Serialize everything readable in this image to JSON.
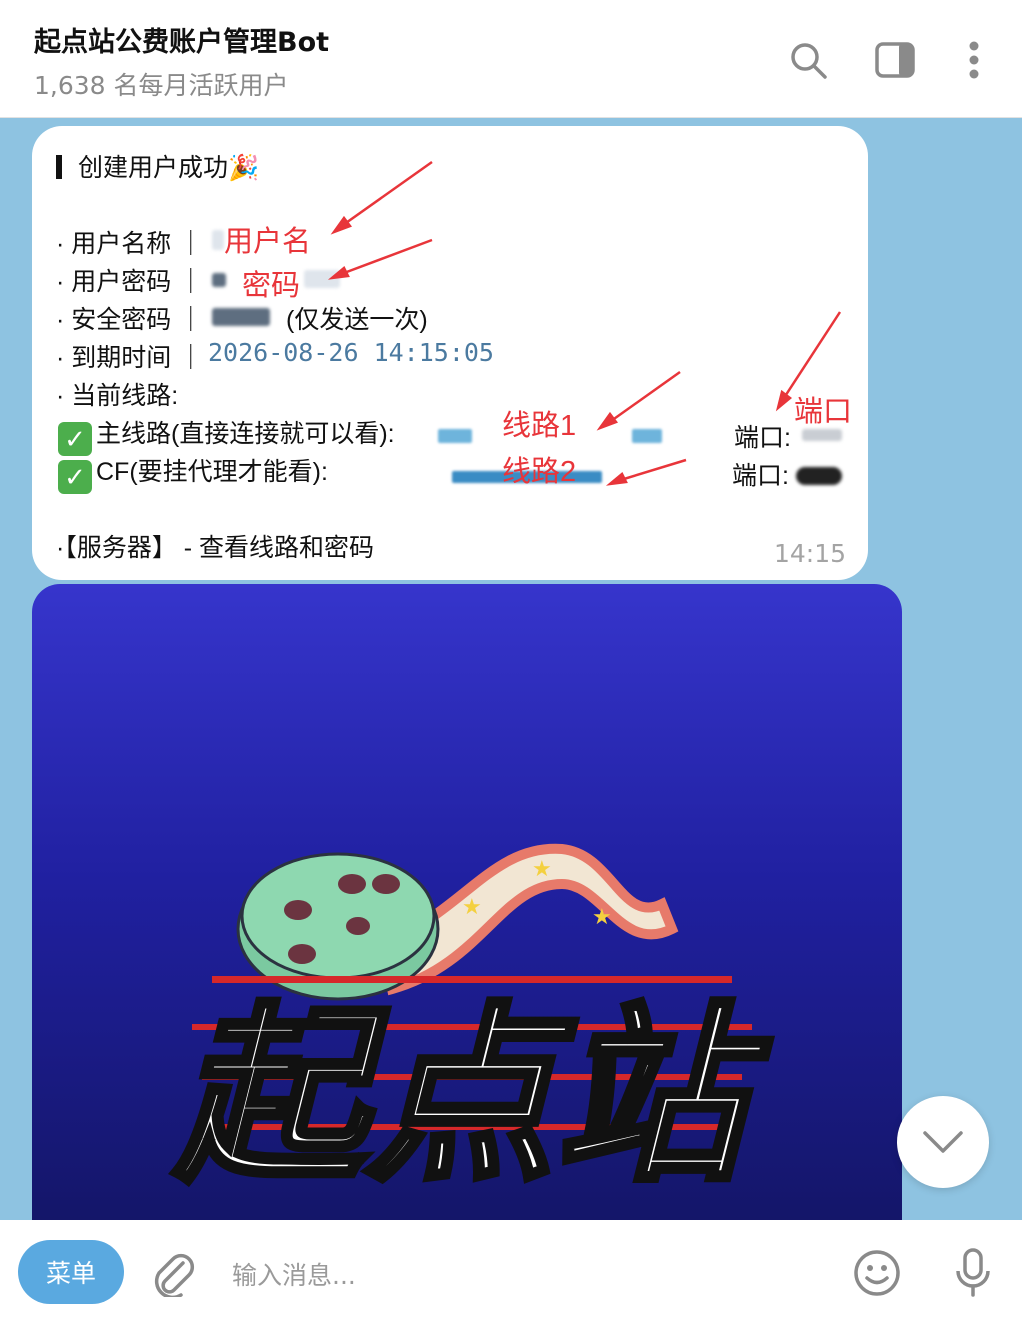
{
  "header": {
    "title": "起点站公费账户管理Bot",
    "subtitle": "1,638 名每月活跃用户",
    "icons": [
      "search-icon",
      "sidebar-toggle-icon",
      "more-vertical-icon"
    ]
  },
  "message": {
    "heading": "创建用户成功🎉",
    "username_label": "· 用户名称 ｜",
    "password_label": "· 用户密码 ｜",
    "security_label": "· 安全密码 ｜",
    "security_note": "(仅发送一次)",
    "expiry_label": "· 到期时间 ｜",
    "expiry_value": "2026-08-26 14:15:05",
    "lines_label": "· 当前线路:",
    "main_line": "主线路(直接连接就可以看):",
    "cf_line": "CF(要挂代理才能看):",
    "port_label": "端口:",
    "server_text": "·【服务器】 - 查看线路和密码",
    "time": "14:15"
  },
  "annotations": {
    "username": "用户名",
    "password": "密码",
    "port": "端口",
    "line1": "线路1",
    "line2": "线路2",
    "color": "#e8353a"
  },
  "media": {
    "logo_text": "起点站",
    "colors": {
      "top": "#3635cc",
      "bottom": "#131565"
    }
  },
  "input": {
    "menu_label": "菜单",
    "placeholder": "输入消息..."
  },
  "colors": {
    "chat_bg": "#8ec3e1",
    "accent": "#5aa9e0",
    "timestamp": "#4b7aa0"
  }
}
